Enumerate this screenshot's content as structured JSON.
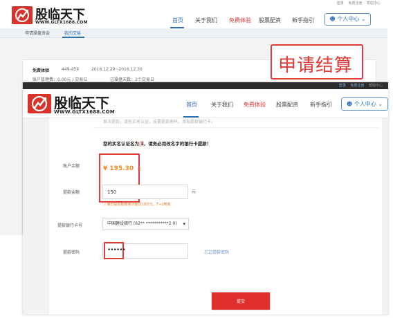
{
  "back_page": {
    "logo": {
      "name": "股临天下",
      "url": "WWW.GLTX1688.COM"
    },
    "nav": [
      "首页",
      "关于我们",
      "免费体验",
      "股票配资",
      "新手指引"
    ],
    "top_links": [
      "登录",
      "免费注册",
      "帮助中心"
    ],
    "user_center": "个人中心",
    "subtabs": [
      "申请操盘资金",
      "我的交易"
    ],
    "record": {
      "title": "免费体验",
      "code": "449-459",
      "dates": "2016.12.29~2016.12.30",
      "fee_label": "账户管理费：0.00元 / 交易日",
      "days_label": "已操盘天数：2个交易日"
    }
  },
  "callout": "申请结算",
  "front_page": {
    "top_links": [
      "登录",
      "免费注册",
      "帮助中心"
    ],
    "logo": {
      "name": "股临天下",
      "url": "WWW.GLTX1688.COM"
    },
    "nav": [
      "首页",
      "关于我们",
      "免费体验",
      "股票配资",
      "新手指引"
    ],
    "user_center": "个人中心",
    "notice": "首次提款，请先实名认证，设置提款密码，添加提款银行卡。",
    "verify_text": "您的实名认证名为",
    "verify_name": "        1",
    "verify_suffix": "，请务必用改名字的银行卡提款！",
    "balance": {
      "label": "账户余额",
      "value": "¥ 195.30",
      "unit": "元"
    },
    "amount": {
      "label": "提款金额",
      "value": "150",
      "unit": "元",
      "hint": "每日提款额度累计超过10万元，T+1到账"
    },
    "bank": {
      "label": "提款银行卡号",
      "value": "中国建设银行 (62**  ***********2 0)"
    },
    "password": {
      "label": "提款密码",
      "value": "••••••",
      "forgot": "忘记提款密码"
    },
    "submit": "提交"
  }
}
